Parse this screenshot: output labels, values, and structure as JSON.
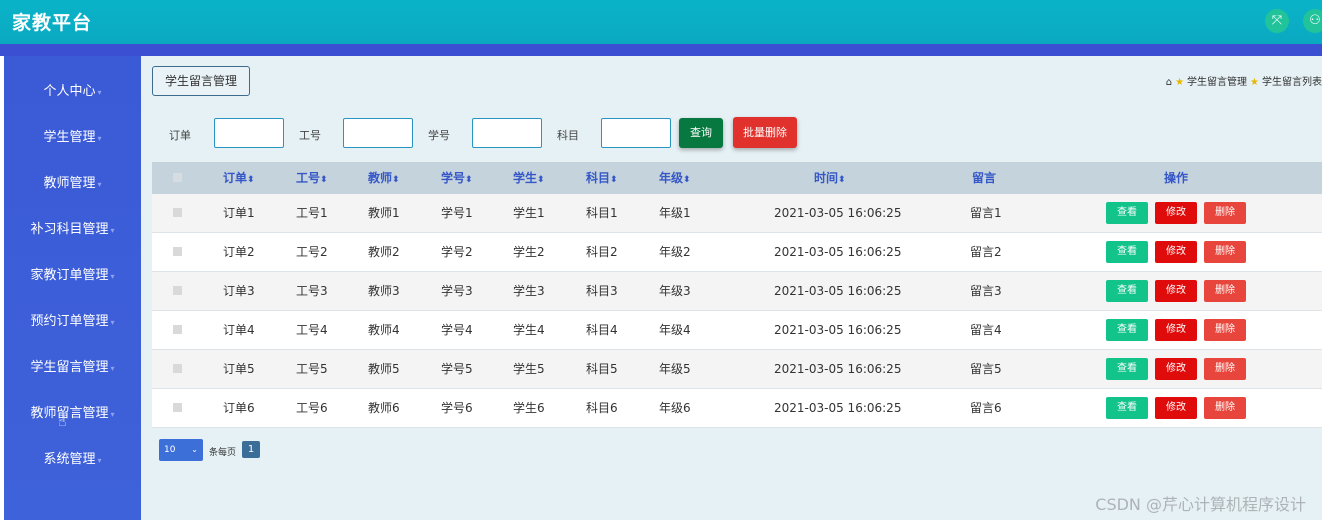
{
  "app": {
    "title": "家教平台"
  },
  "topbar": {
    "icons": [
      "fullscreen-icon",
      "user-icon"
    ]
  },
  "sidebar": {
    "items": [
      {
        "label": "个人中心"
      },
      {
        "label": "学生管理"
      },
      {
        "label": "教师管理"
      },
      {
        "label": "补习科目管理"
      },
      {
        "label": "家教订单管理"
      },
      {
        "label": "预约订单管理"
      },
      {
        "label": "学生留言管理"
      },
      {
        "label": "教师留言管理"
      },
      {
        "label": "系统管理"
      }
    ]
  },
  "page": {
    "title": "学生留言管理",
    "breadcrumb": [
      "学生留言管理",
      "学生留言列表"
    ]
  },
  "filters": {
    "order_label": "订单",
    "teacher_no_label": "工号",
    "student_no_label": "学号",
    "subject_label": "科目",
    "query_button": "查询",
    "batch_delete_button": "批量删除"
  },
  "table": {
    "headers": [
      "订单",
      "工号",
      "教师",
      "学号",
      "学生",
      "科目",
      "年级",
      "时间",
      "留言",
      "操作"
    ],
    "rows": [
      {
        "order": "订单1",
        "teacher_no": "工号1",
        "teacher": "教师1",
        "student_no": "学号1",
        "student": "学生1",
        "subject": "科目1",
        "grade": "年级1",
        "time": "2021-03-05 16:06:25",
        "message": "留言1"
      },
      {
        "order": "订单2",
        "teacher_no": "工号2",
        "teacher": "教师2",
        "student_no": "学号2",
        "student": "学生2",
        "subject": "科目2",
        "grade": "年级2",
        "time": "2021-03-05 16:06:25",
        "message": "留言2"
      },
      {
        "order": "订单3",
        "teacher_no": "工号3",
        "teacher": "教师3",
        "student_no": "学号3",
        "student": "学生3",
        "subject": "科目3",
        "grade": "年级3",
        "time": "2021-03-05 16:06:25",
        "message": "留言3"
      },
      {
        "order": "订单4",
        "teacher_no": "工号4",
        "teacher": "教师4",
        "student_no": "学号4",
        "student": "学生4",
        "subject": "科目4",
        "grade": "年级4",
        "time": "2021-03-05 16:06:25",
        "message": "留言4"
      },
      {
        "order": "订单5",
        "teacher_no": "工号5",
        "teacher": "教师5",
        "student_no": "学号5",
        "student": "学生5",
        "subject": "科目5",
        "grade": "年级5",
        "time": "2021-03-05 16:06:25",
        "message": "留言5"
      },
      {
        "order": "订单6",
        "teacher_no": "工号6",
        "teacher": "教师6",
        "student_no": "学号6",
        "student": "学生6",
        "subject": "科目6",
        "grade": "年级6",
        "time": "2021-03-05 16:06:25",
        "message": "留言6"
      }
    ],
    "actions": {
      "view": "查看",
      "edit": "修改",
      "delete": "删除"
    }
  },
  "pagination": {
    "page_size": "10",
    "per_page_label": "条每页",
    "current_page": "1"
  },
  "watermark": "CSDN @芹心计算机程序设计",
  "colors": {
    "topbar": "#0ab3c8",
    "sidebar": "#3b5ad6",
    "main_bg": "#e6f1f5",
    "query": "#07783f",
    "batch_delete": "#e0312d"
  }
}
